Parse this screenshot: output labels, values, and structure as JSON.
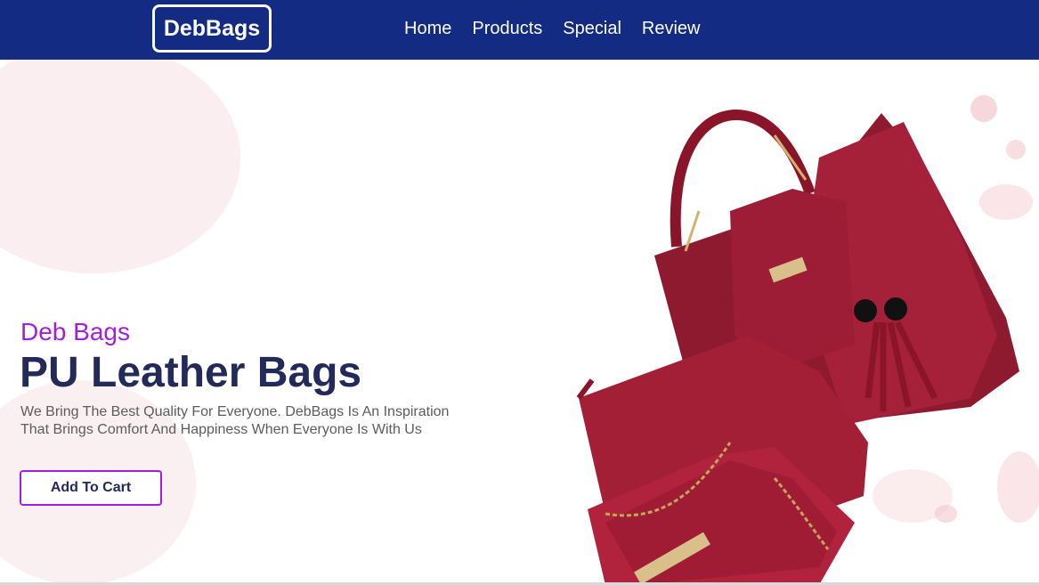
{
  "navbar": {
    "logo": "DebBags",
    "links": [
      "Home",
      "Products",
      "Special",
      "Review"
    ]
  },
  "hero": {
    "subtitle": "Deb Bags",
    "title": "PU Leather Bags",
    "description": "We Bring The Best Quality For Everyone. DebBags Is An Inspiration That Brings Comfort And Happiness When Everyone Is With Us",
    "cta_label": "Add To Cart"
  },
  "colors": {
    "navbar": "#132b82",
    "accent": "#a21fe0",
    "title": "#232a5a",
    "bag": "#9c1b33"
  }
}
